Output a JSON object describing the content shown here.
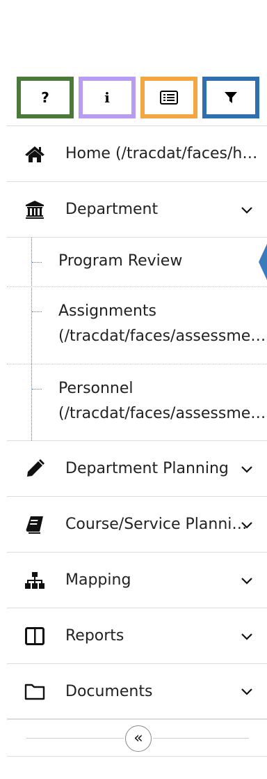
{
  "toolbar": {
    "buttons": [
      {
        "glyph": "?",
        "color": "#4a7a3a",
        "icon": "question-icon"
      },
      {
        "glyph": "i",
        "color": "#b79cf2",
        "icon": "info-icon"
      },
      {
        "glyph": "",
        "color": "#f4a641",
        "icon": "list-icon"
      },
      {
        "glyph": "",
        "color": "#2f6fae",
        "icon": "filter-icon"
      }
    ]
  },
  "nav": {
    "items": [
      {
        "label": "Home (/tracdat/faces/home)",
        "icon": "home-icon",
        "expandable": false
      },
      {
        "label": "Department",
        "icon": "institution-icon",
        "expandable": true,
        "expanded": true,
        "children": [
          {
            "label": "Program Review",
            "lines": [
              "Program Review"
            ]
          },
          {
            "label": "Assignments (/tracdat/faces/assessment...)",
            "lines": [
              "Assignments",
              "(/tracdat/faces/assessment...)"
            ]
          },
          {
            "label": "Personnel (/tracdat/faces/assessment...)",
            "lines": [
              "Personnel",
              "(/tracdat/faces/assessment...)"
            ]
          }
        ]
      },
      {
        "label": "Department Planning",
        "icon": "pencil-icon",
        "expandable": true
      },
      {
        "label": "Course/Service Planning",
        "icon": "book-icon",
        "expandable": true
      },
      {
        "label": "Mapping",
        "icon": "sitemap-icon",
        "expandable": true
      },
      {
        "label": "Reports",
        "icon": "columns-icon",
        "expandable": true
      },
      {
        "label": "Documents",
        "icon": "folder-icon",
        "expandable": true
      }
    ]
  },
  "collapse": {
    "glyph": "«"
  },
  "colors": {
    "accent": "#3a7bbd"
  }
}
